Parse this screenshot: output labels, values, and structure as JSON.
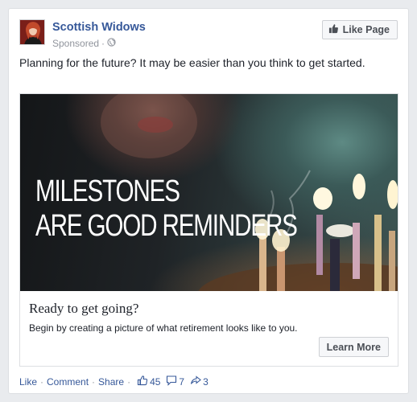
{
  "post": {
    "page_name": "Scottish Widows",
    "sponsored_label": "Sponsored",
    "separator": "·",
    "like_page_label": "Like Page",
    "message": "Planning for the future? It may be easier than you think to get started."
  },
  "ad": {
    "headline_line1": "MILESTONES",
    "headline_line2": "ARE GOOD REMINDERS",
    "title": "Ready to get going?",
    "description": "Begin by creating a picture of what retirement looks like to you.",
    "cta_label": "Learn More"
  },
  "footer": {
    "like_label": "Like",
    "comment_label": "Comment",
    "share_label": "Share",
    "separator": "·",
    "likes_count": "45",
    "comments_count": "7",
    "shares_count": "3"
  },
  "icons": {
    "globe": "globe-icon",
    "thumbs_up": "thumbs-up-icon",
    "comment": "comment-icon",
    "share": "share-icon"
  },
  "colors": {
    "link_blue": "#365899",
    "text": "#1d2129",
    "muted": "#90949c",
    "background": "#e9ebee",
    "button_bg": "#f6f7f9"
  }
}
